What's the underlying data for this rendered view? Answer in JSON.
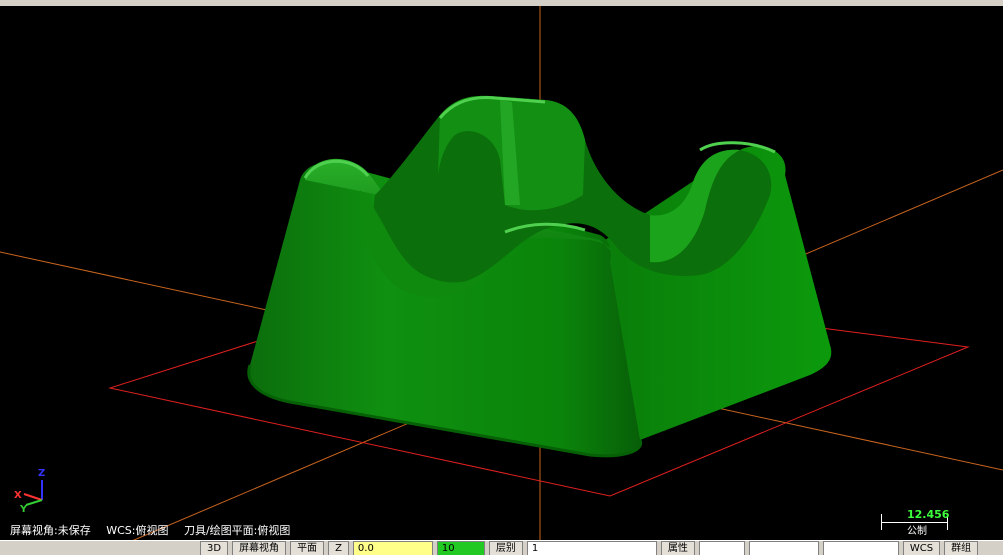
{
  "viewport": {
    "status_items": [
      "屏幕视角:未保存",
      "WCS:俯视图",
      "刀具/绘图平面:俯视图"
    ],
    "axis_labels": {
      "z": "Z",
      "y": "Y",
      "x": "X"
    },
    "scale": {
      "value": "12.456",
      "unit": "公制"
    },
    "colors": {
      "part": "#0a8a0a",
      "background": "#000000",
      "axis_line": "#c8641e",
      "plane_outline": "#e02020",
      "scale_value": "#3cff3c"
    }
  },
  "statusbar": {
    "view_mode": "3D",
    "screen_view": "屏幕视角",
    "plane": "平面",
    "z_label": "Z",
    "z_value": "0.0",
    "color_value": "10",
    "level_label": "层别",
    "level_value": "1",
    "attributes_label": "属性",
    "wcs_label": "WCS",
    "group_label": "群组"
  }
}
